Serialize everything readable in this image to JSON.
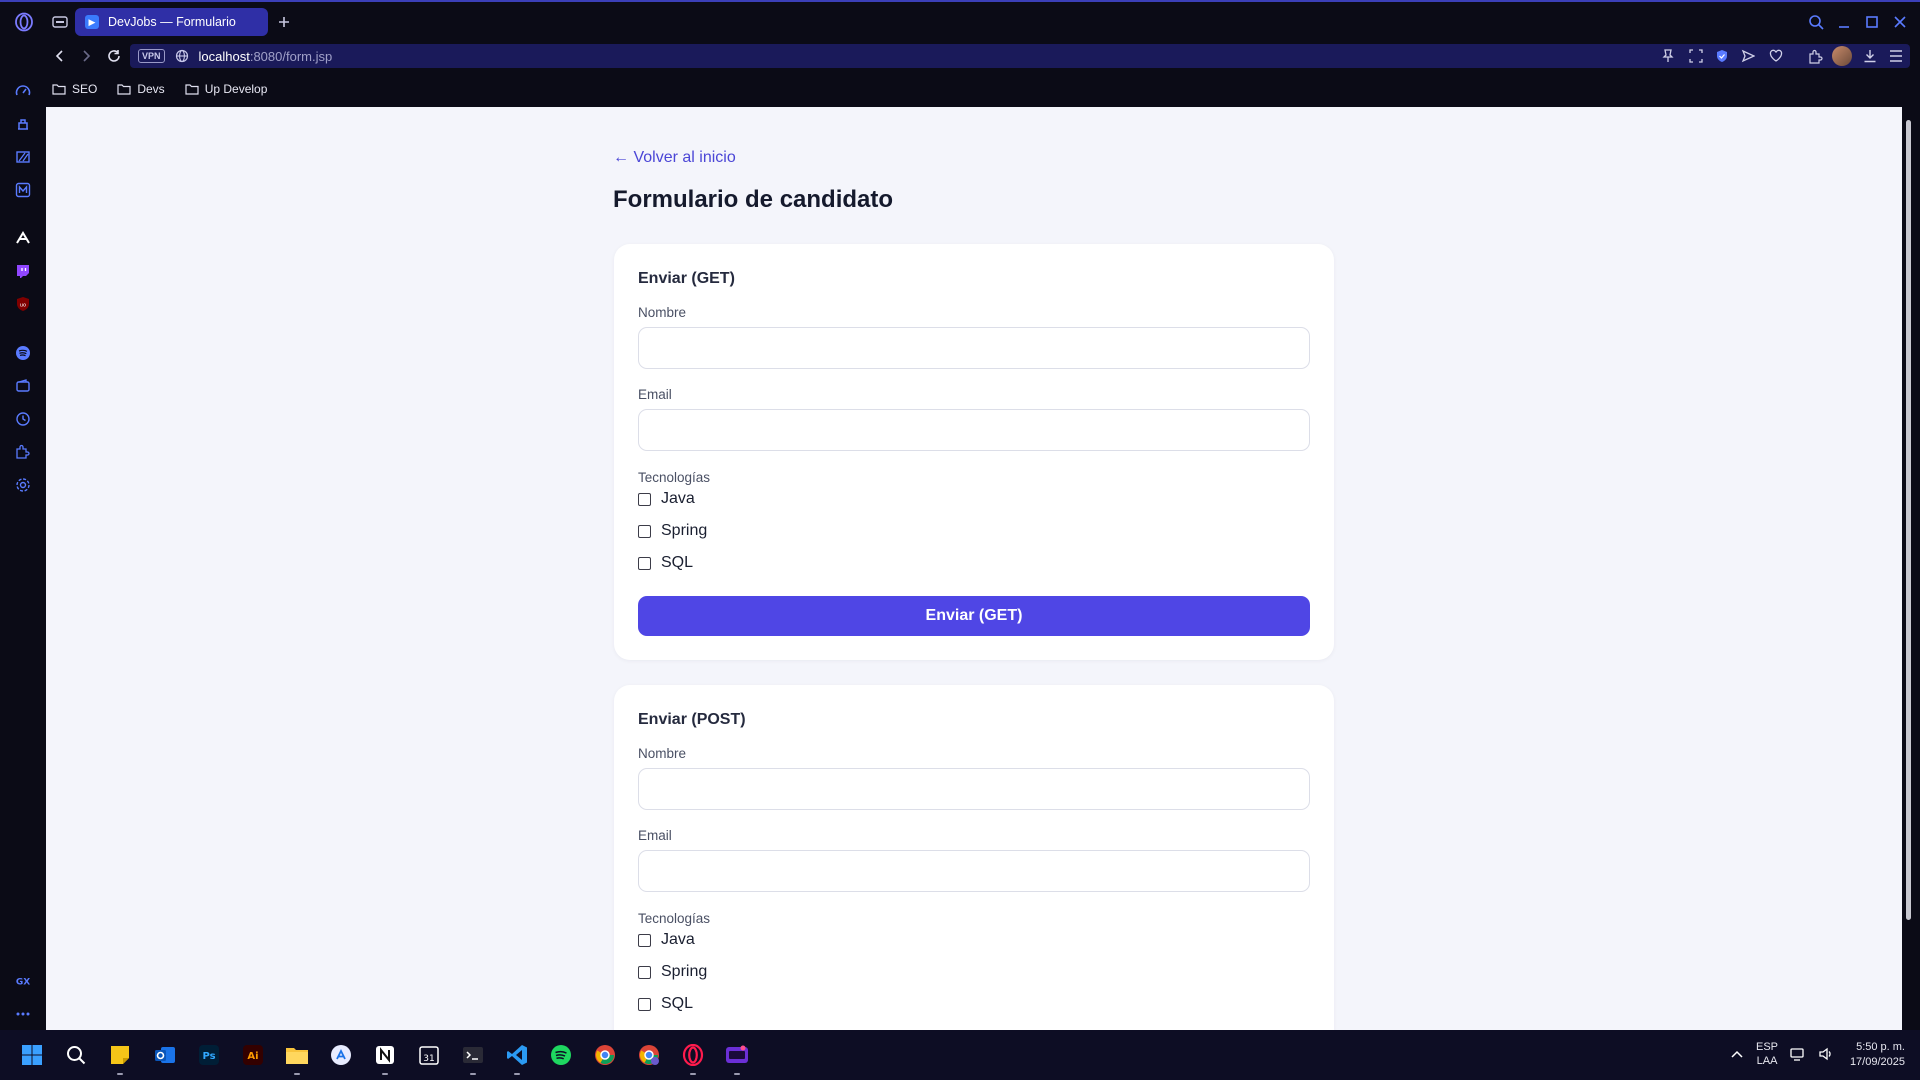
{
  "browser": {
    "tab_title": "DevJobs — Formulario",
    "tab_favicon": "devjobs-favicon",
    "url_host": "localhost",
    "url_rest": ":8080/form.jsp",
    "vpn_label": "VPN",
    "bookmarks": [
      {
        "label": "SEO",
        "icon": "folder-icon"
      },
      {
        "label": "Devs",
        "icon": "folder-icon"
      },
      {
        "label": "Up Develop",
        "icon": "folder-icon"
      }
    ],
    "accent": "#2f2fa6"
  },
  "page": {
    "back_link": "← Volver al inicio",
    "title": "Formulario de candidato",
    "accent_color": "#4f46e5",
    "forms": [
      {
        "heading": "Enviar (GET)",
        "name_label": "Nombre",
        "name_value": "",
        "email_label": "Email",
        "email_value": "",
        "tech_label": "Tecnologías",
        "options": [
          "Java",
          "Spring",
          "SQL"
        ],
        "checked": [
          false,
          false,
          false
        ],
        "submit_label": "Enviar (GET)"
      },
      {
        "heading": "Enviar (POST)",
        "name_label": "Nombre",
        "name_value": "",
        "email_label": "Email",
        "email_value": "",
        "tech_label": "Tecnologías",
        "options": [
          "Java",
          "Spring",
          "SQL"
        ],
        "checked": [
          false,
          false,
          false
        ]
      }
    ]
  },
  "taskbar": {
    "language": "ESP",
    "layout": "LAA",
    "time": "5:50 p. m.",
    "date": "17/09/2025"
  }
}
